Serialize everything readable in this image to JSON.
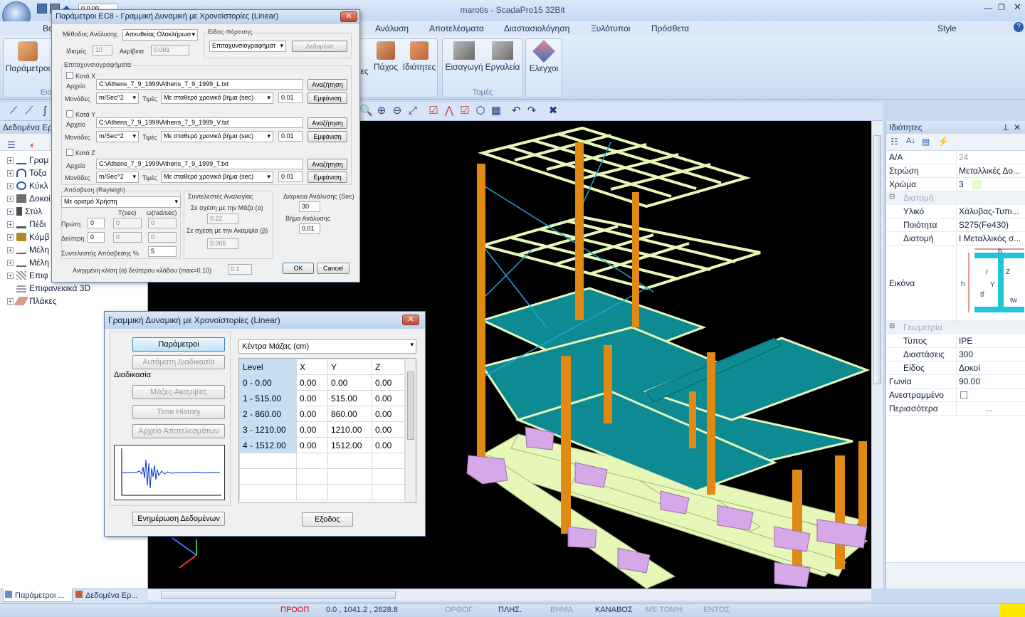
{
  "app": {
    "title": "marotis - ScadaPro15 32Bit",
    "style_label": "Style"
  },
  "qat": {
    "coord_value": "0.0.00"
  },
  "menu": [
    "Βο",
    "Ανάλυση",
    "Αποτελέσματα",
    "Διαστασιολόγηση",
    "Ξυλότυποι",
    "Πρόσθετα"
  ],
  "ribbon": {
    "params_label": "Παράμετροι",
    "params_group": "Εισ",
    "buttons": [
      {
        "label": "ες"
      },
      {
        "label": "Πάχος"
      },
      {
        "label": "Ιδιότητες"
      },
      {
        "label": "Εισαγωγή"
      },
      {
        "label": "Εργαλεία"
      },
      {
        "label": "Ελεγχοι"
      }
    ],
    "group_label": "Τομές"
  },
  "left_panel": {
    "title": "Δεδομένα Ερ",
    "tree": [
      "Γραμ",
      "Τόξα",
      "Κύκλ",
      "Δοκοί",
      "Στύλ",
      "Πέδι",
      "Κόμβ",
      "Μέλη",
      "Μέλη",
      "Επιφ",
      "Επιφανειακά 3D",
      "Πλάκες"
    ],
    "tabs": [
      "Παράμετροι ...",
      "Δεδομένα Ερ..."
    ]
  },
  "properties": {
    "title": "Ιδιότητες",
    "rows": [
      {
        "k": "Α/Α",
        "v": "24"
      },
      {
        "k": "Στρώση",
        "v": "Μεταλλικές Δο..."
      },
      {
        "k": "Χρώμα",
        "v": "3"
      }
    ],
    "cat_section": "Διατομή",
    "section_rows": [
      {
        "k": "Υλικό",
        "v": "Χάλυβας-Τυπι..."
      },
      {
        "k": "Ποιότητα",
        "v": "S275(Fe430)"
      },
      {
        "k": "Διατομή",
        "v": "I Μεταλλικός σ..."
      }
    ],
    "image_label": "Εικόνα",
    "image_marks": {
      "b": "b",
      "r": "r",
      "h": "h",
      "tf": "tf",
      "tw": "tw",
      "y": "Y",
      "z": "Z"
    },
    "cat_geometry": "Γεωμετρία",
    "geo_rows": [
      {
        "k": "Τύπος",
        "v": "IPE"
      },
      {
        "k": "Διαστάσεις",
        "v": "300"
      },
      {
        "k": "Είδος",
        "v": "Δοκοί"
      },
      {
        "k": "Γωνία",
        "v": "90.00"
      }
    ],
    "bool_row": {
      "k": "Ανεστραμμένο"
    },
    "more_row": {
      "k": "Περισσότερα",
      "v": "..."
    }
  },
  "dialog_ec8": {
    "title": "Παράμετροι EC8 - Γραμμική Δυναμική με Χρονοϊστορίες (Linear)",
    "method_label": "Μέθοδος Ανάλυσης",
    "method_value": "Απευθείας Ολοκλήρωσ",
    "load_type_label": "Είδος Φόρτισης",
    "load_type_value": "Επιταχυνσιογραφήματ",
    "data_button": "Δεδομένα",
    "eigen_label": "Ιδιομές",
    "eigen_value": "10",
    "accuracy_label": "Ακρίβεια",
    "accuracy_value": "0.001",
    "accel_label": "Επιταχυνσιογραφήματα",
    "axes": [
      {
        "check": "Κατά Χ",
        "file": "C:\\Athens_7_9_1999\\Athens_7_9_1999_L.txt",
        "units": "m/Sec^2",
        "mode": "Με σταθερό χρονικό βήμα (sec)",
        "step": "0.01"
      },
      {
        "check": "Κατά Υ",
        "file": "C:\\Athens_7_9_1999\\Athens_7_9_1999_V.txt",
        "units": "m/Sec^2",
        "mode": "Με σταθερό χρονικό βήμα (sec)",
        "step": "0.01"
      },
      {
        "check": "Κατά Ζ",
        "file": "C:\\Athens_7_9_1999\\Athens_7_9_1999_T.txt",
        "units": "m/Sec^2",
        "mode": "Με σταθερό χρονικό βήμα (sec)",
        "step": "0.01"
      }
    ],
    "file_label": "Αρχείο",
    "units_label": "Μονάδες",
    "values_label": "Τιμές",
    "search_button": "Αναζήτηση",
    "show_button": "Εμφάνιση",
    "damping_label": "Απόσβεση (Rayleigh)",
    "damping_value": "Με ορισμό Χρήστη",
    "t_label": "T(sec)",
    "w_label": "ω(rad/sec)",
    "first_label": "Πρώτη",
    "first_val": "0",
    "first_t": "0",
    "first_w": "0",
    "second_label": "Δεύτερη",
    "second_val": "0",
    "second_t": "0",
    "second_w": "0",
    "damp_coef_label": "Συντελεστής Απόσβεσης %",
    "damp_coef_value": "5",
    "coef_title": "Συντελεστές Αναλογίας",
    "mass_label": "Σε σχέση με την Μάζα (α)",
    "mass_value": "0.22",
    "stiff_label": "Σε σχέση με την Ακαμψία (β)",
    "stiff_value": "0.005",
    "duration_label": "Διάρκεια Ανάλυσης (Sec)",
    "duration_value": "30",
    "step_label": "Βήμα Ανάλυσης",
    "step_value": "0.01",
    "slope_label": "Ανηγμένη κλίση (α) δεύτερου κλάδου (max=0.10)",
    "slope_value": "0.1",
    "ok": "OK",
    "cancel": "Cancel"
  },
  "dialog_linear": {
    "title": "Γραμμική Δυναμική με Χρονοϊστορίες (Linear)",
    "btn_params": "Παράμετροι",
    "btn_auto": "Αυτόματη Διαδικασία",
    "proc_label": "Διαδικασία",
    "btn_mass": "Μάζες-Ακαμψίες",
    "btn_time": "Time History",
    "btn_results": "Αρχείο Αποτελεσμάτων",
    "btn_update": "Ενημέρωση Δεδομένων",
    "btn_exit": "Εξοδος",
    "combo": "Κέντρα Μάζας (cm)",
    "columns": [
      "Level",
      "X",
      "Y",
      "Z"
    ],
    "rows": [
      [
        "0 - 0.00",
        "0.00",
        "0.00",
        "0.00"
      ],
      [
        "1 - 515.00",
        "0.00",
        "515.00",
        "0.00"
      ],
      [
        "2 - 860.00",
        "0.00",
        "860.00",
        "0.00"
      ],
      [
        "3 - 1210.00",
        "0.00",
        "1210.00",
        "0.00"
      ],
      [
        "4 - 1512.00",
        "0.00",
        "1512.00",
        "0.00"
      ]
    ]
  },
  "status": {
    "proop": "ΠΡΟΟΠ",
    "coords": "0.0 , 1041.2 , 2628.8",
    "ortho": "ΟΡΘΟΓ.",
    "plis": "ΠΛΗΣ.",
    "vima": "ΒΗΜΑ",
    "kanavos": "ΚΑΝΑΒΟΣ",
    "metomi": "ΜΕ ΤΟΜΗ",
    "entos": "ΕΝΤΟΣ"
  },
  "colors": {
    "accent": "#1a3f80",
    "status_red": "#d0021b",
    "frame_orange": "#e08a14",
    "slab_teal": "#0e8a93",
    "beam_green": "#e6f7b8",
    "base_pink": "#d6a8e8"
  }
}
